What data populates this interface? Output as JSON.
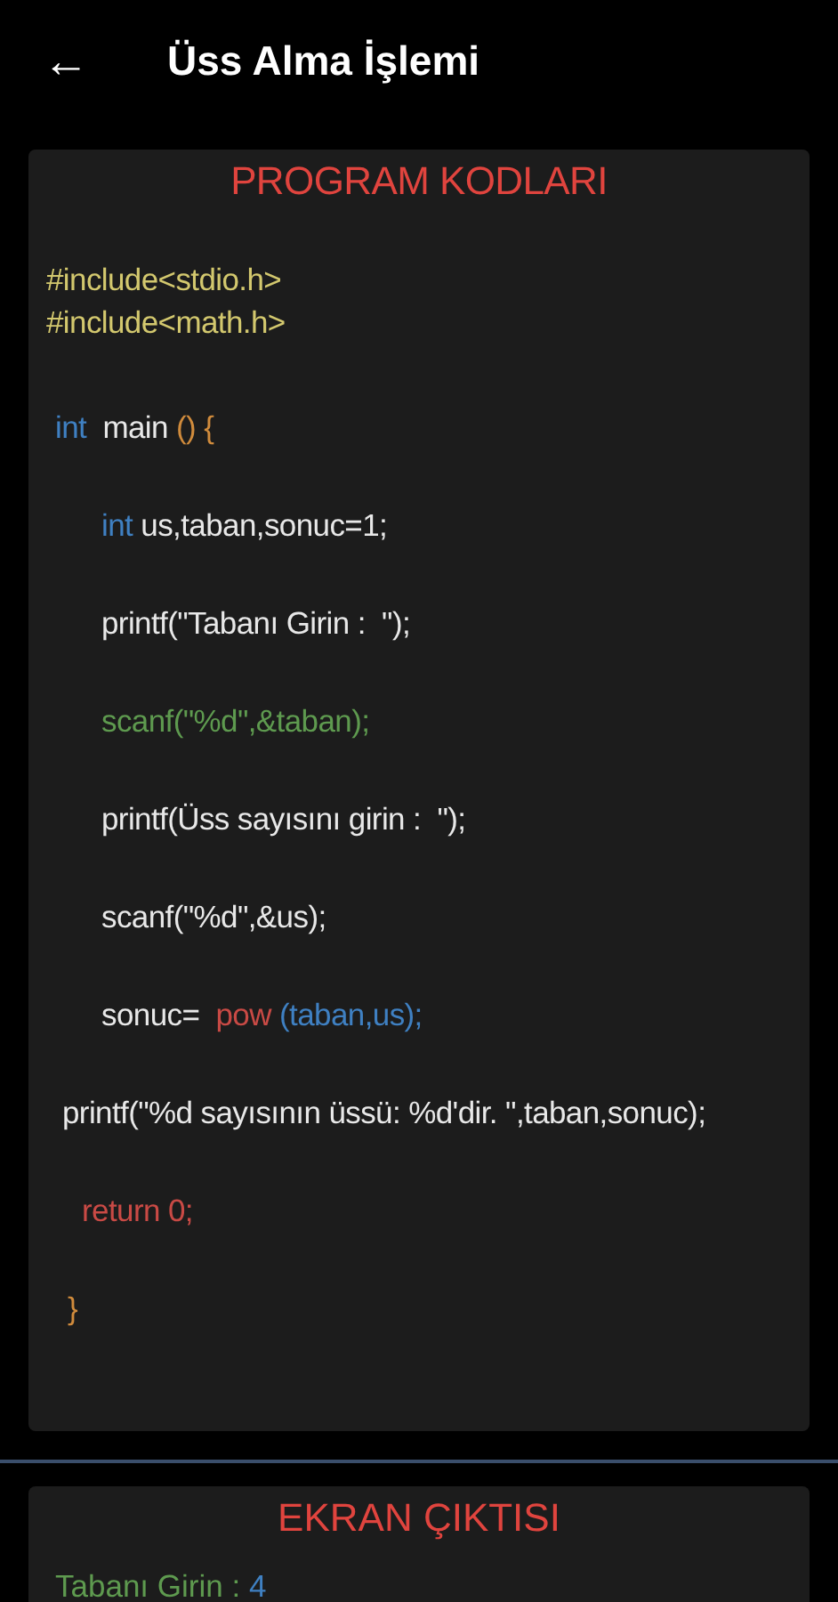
{
  "app_bar": {
    "back_icon": "←",
    "title": "Üss Alma İşlemi"
  },
  "code_card": {
    "title": "PROGRAM KODLARI",
    "lines": [
      {
        "kind": "include",
        "segments": [
          {
            "kind": "preproc",
            "text": "#include<stdio.h>"
          }
        ]
      },
      {
        "kind": "include",
        "segments": [
          {
            "kind": "preproc",
            "text": "#include<math.h>"
          }
        ]
      },
      {
        "kind": "outer",
        "segments": [
          {
            "kind": "keyword",
            "text": "int"
          },
          {
            "kind": "plain",
            "text": "  main "
          },
          {
            "kind": "brace",
            "text": "() {"
          }
        ]
      },
      {
        "kind": "body",
        "segments": [
          {
            "kind": "keyword",
            "text": "int"
          },
          {
            "kind": "plain",
            "text": " us,taban,sonuc=1;"
          }
        ]
      },
      {
        "kind": "body",
        "segments": [
          {
            "kind": "plain",
            "text": "printf(\"Tabanı Girin :  \");"
          }
        ]
      },
      {
        "kind": "body",
        "segments": [
          {
            "kind": "input",
            "text": "scanf(\"%d\",&taban);"
          }
        ]
      },
      {
        "kind": "body",
        "segments": [
          {
            "kind": "plain",
            "text": "printf(Üss sayısını girin :  \");"
          }
        ]
      },
      {
        "kind": "body",
        "segments": [
          {
            "kind": "plain",
            "text": "scanf(\"%d\",&us);"
          }
        ]
      },
      {
        "kind": "body",
        "segments": [
          {
            "kind": "plain",
            "text": "sonuc=  "
          },
          {
            "kind": "call",
            "text": "pow "
          },
          {
            "kind": "keyword",
            "text": "(taban,us);"
          }
        ]
      },
      {
        "kind": "wide",
        "segments": [
          {
            "kind": "plain",
            "text": "printf(\"%d sayısının üssü: %d'dir. \",taban,sonuc);"
          }
        ]
      },
      {
        "kind": "ret",
        "segments": [
          {
            "kind": "call",
            "text": "return 0;"
          }
        ]
      },
      {
        "kind": "close",
        "segments": [
          {
            "kind": "brace",
            "text": "}"
          }
        ]
      }
    ]
  },
  "output_card": {
    "title": "EKRAN ÇIKTISI",
    "lines": [
      {
        "segments": [
          {
            "kind": "input",
            "text": "Tabanı Girin : "
          },
          {
            "kind": "keyword",
            "text": "4"
          }
        ]
      }
    ]
  }
}
